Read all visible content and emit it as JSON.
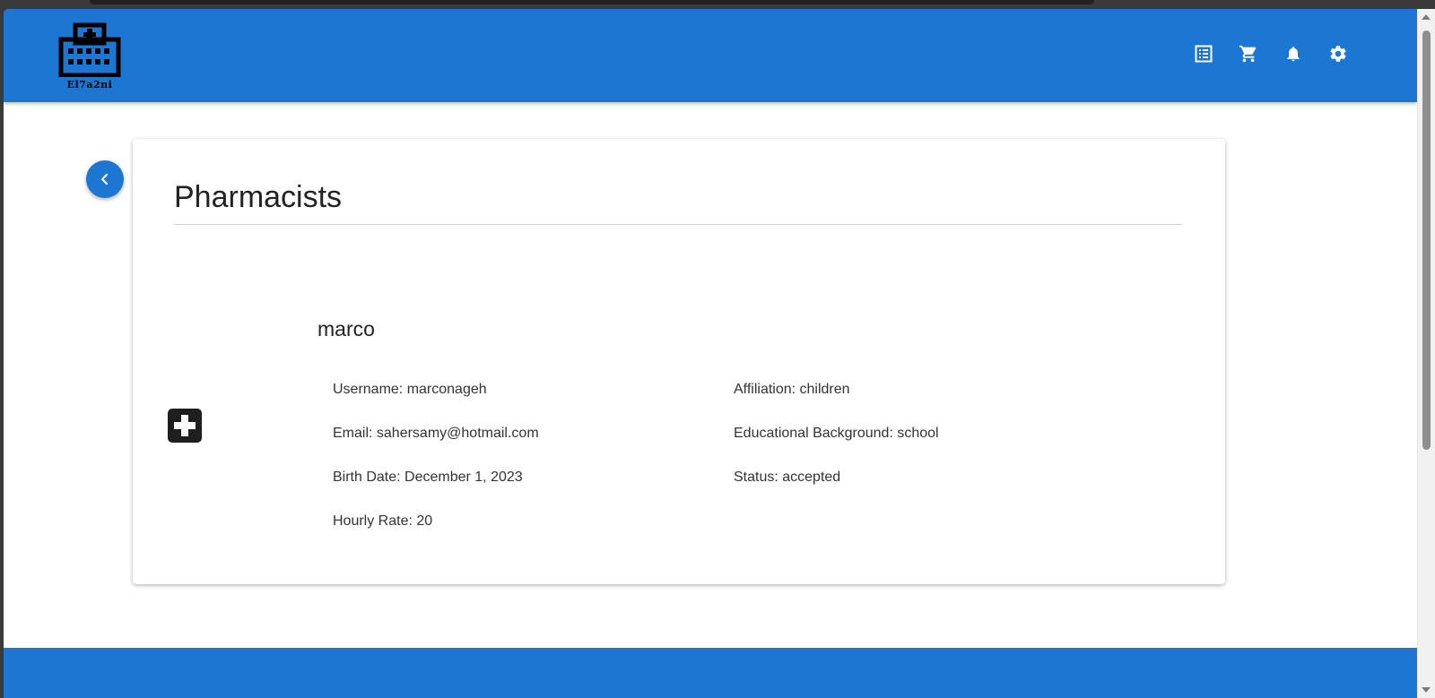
{
  "app": {
    "logo_text": "El7a2ni"
  },
  "header": {
    "icons": [
      "list-icon",
      "cart-icon",
      "bell-icon",
      "gear-icon"
    ]
  },
  "page": {
    "title": "Pharmacists"
  },
  "pharmacist": {
    "name": "marco",
    "username": "Username: marconageh",
    "email": "Email: sahersamy@hotmail.com",
    "birth_date": "Birth Date: December 1, 2023",
    "hourly_rate": "Hourly Rate: 20",
    "affiliation": "Affiliation: children",
    "education": "Educational Background: school",
    "status": "Status: accepted"
  },
  "colors": {
    "primary": "#1c77d2",
    "card_bg": "#ffffff",
    "text": "#222222"
  }
}
